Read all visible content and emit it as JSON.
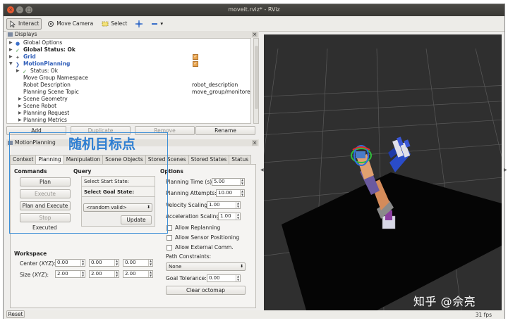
{
  "window": {
    "title": "moveit.rviz* - RViz",
    "close_glyph": "×",
    "min_glyph": "–",
    "max_glyph": "□"
  },
  "toolbar": {
    "interact": "Interact",
    "move_camera": "Move Camera",
    "select": "Select",
    "dropdown_glyph": "▾"
  },
  "displays_panel": {
    "title": "Displays",
    "close_glyph": "×",
    "rows": [
      {
        "label": "Global Options",
        "value": ""
      },
      {
        "label": "Global Status: Ok",
        "value": ""
      },
      {
        "label": "Grid",
        "value": ""
      },
      {
        "label": "MotionPlanning",
        "value": ""
      },
      {
        "label": "Status: Ok",
        "value": ""
      },
      {
        "label": "Move Group Namespace",
        "value": ""
      },
      {
        "label": "Robot Description",
        "value": "robot_description"
      },
      {
        "label": "Planning Scene Topic",
        "value": "move_group/monitore..."
      },
      {
        "label": "Scene Geometry",
        "value": ""
      },
      {
        "label": "Scene Robot",
        "value": ""
      },
      {
        "label": "Planning Request",
        "value": ""
      },
      {
        "label": "Planning Metrics",
        "value": ""
      }
    ],
    "buttons": {
      "add": "Add",
      "duplicate": "Duplicate",
      "remove": "Remove",
      "rename": "Rename"
    }
  },
  "motion_panel": {
    "title": "MotionPlanning",
    "close_glyph": "×",
    "tabs": [
      "Context",
      "Planning",
      "Manipulation",
      "Scene Objects",
      "Stored Scenes",
      "Stored States",
      "Status"
    ],
    "commands": {
      "heading": "Commands",
      "plan": "Plan",
      "execute": "Execute",
      "plan_and_execute": "Plan and Execute",
      "stop": "Stop",
      "status": "Executed"
    },
    "query": {
      "heading": "Query",
      "start_state": "Select Start State:",
      "goal_state": "Select Goal State:",
      "goal_option": "<random valid>",
      "update": "Update"
    },
    "options": {
      "heading": "Options",
      "planning_time_label": "Planning Time (s):",
      "planning_time": "5.00",
      "planning_attempts_label": "Planning Attempts:",
      "planning_attempts": "10.00",
      "velocity_scaling_label": "Velocity Scaling:",
      "velocity_scaling": "1.00",
      "acceleration_scaling_label": "Acceleration Scaling:",
      "acceleration_scaling": "1.00",
      "allow_replanning": "Allow Replanning",
      "allow_sensor_positioning": "Allow Sensor Positioning",
      "allow_external_comm": "Allow External Comm.",
      "path_constraints_label": "Path Constraints:",
      "path_constraints": "None",
      "goal_tolerance_label": "Goal Tolerance:",
      "goal_tolerance": "0.00",
      "clear_octomap": "Clear octomap"
    },
    "workspace": {
      "heading": "Workspace",
      "center_label": "Center (XYZ):",
      "center": [
        "0.00",
        "0.00",
        "0.00"
      ],
      "size_label": "Size (XYZ):",
      "size": [
        "2.00",
        "2.00",
        "2.00"
      ]
    }
  },
  "annotation": {
    "text": "随机目标点",
    "color": "#3d8fd6"
  },
  "status_bar": {
    "reset": "Reset",
    "fps": "31 fps"
  },
  "watermark": "知乎 @佘亮",
  "colors": {
    "title_bar": "#3f3e3a",
    "close_button": "#e6582f",
    "link_blue": "#2d5cb8",
    "checkbox_orange": "#e8a44e",
    "viewport_bg": "#2f2f2f",
    "floor": "#050505"
  },
  "icons": [
    "interact-icon",
    "move-camera-icon",
    "select-icon",
    "focus-camera-icon",
    "displays-icon",
    "grid-icon",
    "motion-planning-icon",
    "check-icon"
  ]
}
